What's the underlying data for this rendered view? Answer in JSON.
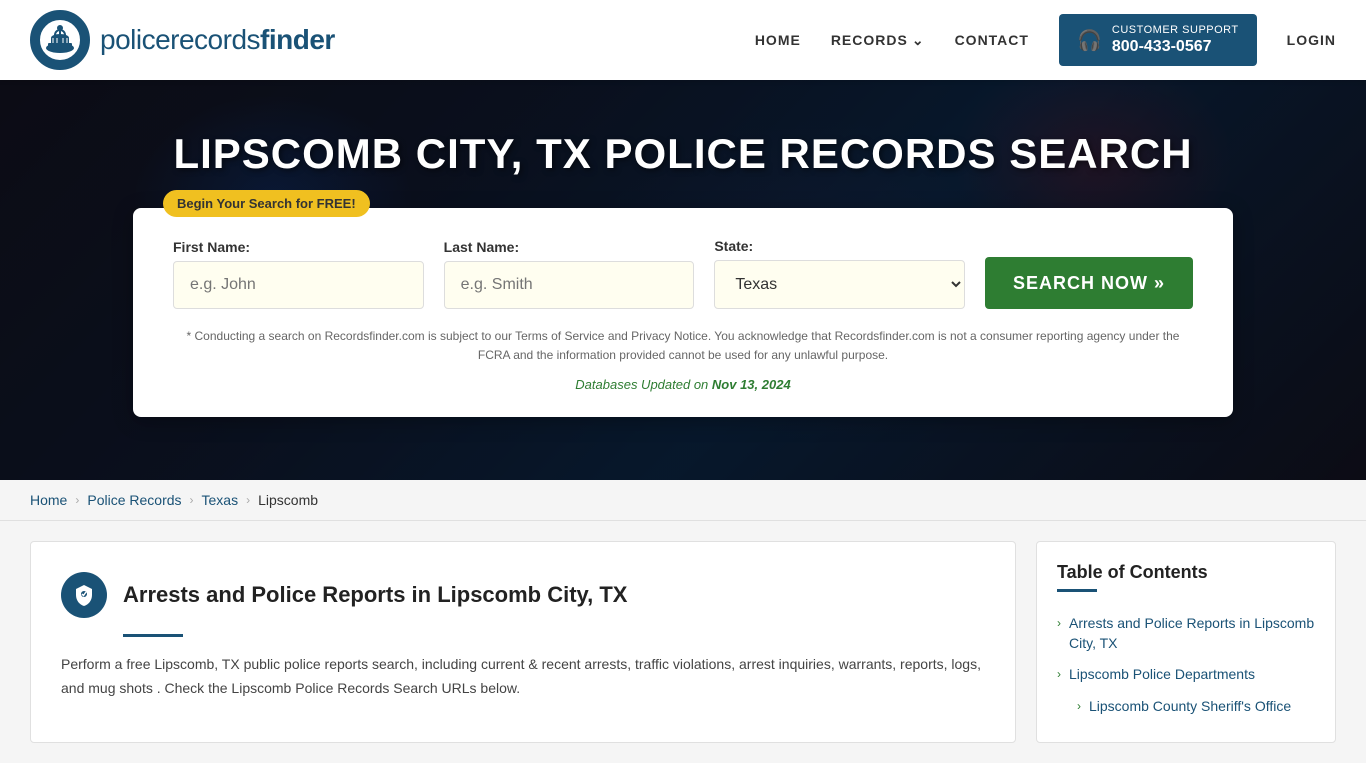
{
  "header": {
    "logo_text_light": "policerecords",
    "logo_text_bold": "finder",
    "nav": {
      "home": "HOME",
      "records": "RECORDS",
      "contact": "CONTACT",
      "login": "LOGIN"
    },
    "support": {
      "label": "CUSTOMER SUPPORT",
      "number": "800-433-0567"
    }
  },
  "hero": {
    "title": "LIPSCOMB CITY, TX POLICE RECORDS SEARCH",
    "badge": "Begin Your Search for FREE!"
  },
  "search_form": {
    "first_name_label": "First Name:",
    "first_name_placeholder": "e.g. John",
    "last_name_label": "Last Name:",
    "last_name_placeholder": "e.g. Smith",
    "state_label": "State:",
    "state_value": "Texas",
    "search_button": "SEARCH NOW »",
    "disclaimer_text": "* Conducting a search on Recordsfinder.com is subject to our Terms of Service and Privacy Notice. You acknowledge that Recordsfinder.com is not a consumer reporting agency under the FCRA and the information provided cannot be used for any unlawful purpose.",
    "db_updated_prefix": "Databases Updated on ",
    "db_updated_date": "Nov 13, 2024"
  },
  "breadcrumb": {
    "items": [
      "Home",
      "Police Records",
      "Texas",
      "Lipscomb"
    ]
  },
  "main": {
    "section_title": "Arrests and Police Reports in Lipscomb City, TX",
    "section_body": "Perform a free Lipscomb, TX public police reports search, including current & recent arrests, traffic violations, arrest inquiries, warrants, reports, logs, and mug shots . Check the Lipscomb Police Records Search URLs below."
  },
  "toc": {
    "title": "Table of Contents",
    "items": [
      {
        "label": "Arrests and Police Reports in Lipscomb City, TX",
        "indent": false
      },
      {
        "label": "Lipscomb Police Departments",
        "indent": false
      },
      {
        "label": "Lipscomb County Sheriff's Office",
        "indent": true
      }
    ]
  },
  "colors": {
    "primary_blue": "#1a5276",
    "primary_green": "#2e7d32",
    "badge_yellow": "#f0c020"
  }
}
